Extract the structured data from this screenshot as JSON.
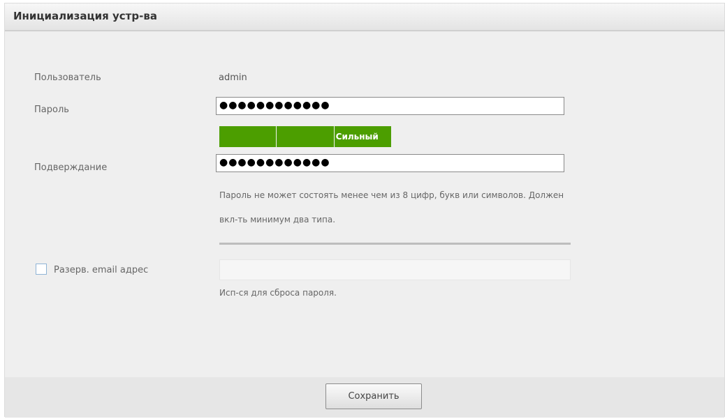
{
  "title": "Инициализация устр-ва",
  "form": {
    "user_label": "Пользователь",
    "user_value": "admin",
    "password_label": "Пароль",
    "password_value": "●●●●●●●●●●●●",
    "strength_label": "Сильный",
    "strength_level": "strong",
    "strength_color": "#4c9e00",
    "confirm_label": "Подверждание",
    "confirm_value": "●●●●●●●●●●●●",
    "hint_line1": "Пароль не может состоять менее чем из 8 цифр, букв или символов. Должен",
    "hint_line2": "вкл-ть минимум два типа.",
    "email_label": "Разерв. email адрес",
    "email_value": "",
    "email_hint": "Исп-ся для сброса пароля."
  },
  "footer": {
    "save_label": "Сохранить"
  }
}
